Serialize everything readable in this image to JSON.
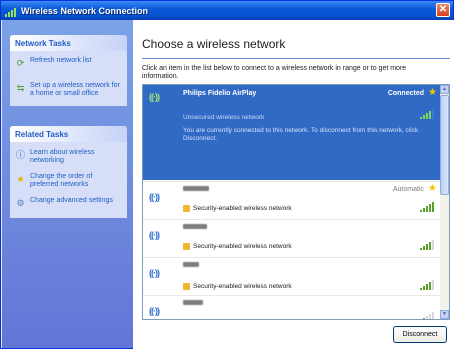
{
  "window": {
    "title": "Wireless Network Connection",
    "close_glyph": "✕"
  },
  "sidebar": {
    "network_tasks": {
      "header": "Network Tasks",
      "items": [
        {
          "label": "Refresh network list",
          "icon": "refresh-icon"
        },
        {
          "label": "Set up a wireless network for a home or small office",
          "icon": "setup-network-icon"
        }
      ]
    },
    "related_tasks": {
      "header": "Related Tasks",
      "items": [
        {
          "label": "Learn about wireless networking",
          "icon": "info-icon"
        },
        {
          "label": "Change the order of preferred networks",
          "icon": "star-icon"
        },
        {
          "label": "Change advanced settings",
          "icon": "settings-icon"
        }
      ]
    }
  },
  "main": {
    "title": "Choose a wireless network",
    "instructions": "Click an item in the list below to connect to a wireless network in range or to get more information.",
    "networks": [
      {
        "name": "Philips Fidelio AirPlay",
        "status": "Connected",
        "security": "Unsecured wireless network",
        "description": "You are currently connected to this network. To disconnect from this network, click Disconnect.",
        "selected": true,
        "signal": 4
      },
      {
        "name": "",
        "status": "Automatic",
        "security": "Security-enabled wireless network",
        "selected": false,
        "signal": 5
      },
      {
        "name": "",
        "status": "",
        "security": "Security-enabled wireless network",
        "selected": false,
        "signal": 4
      },
      {
        "name": "",
        "status": "",
        "security": "Security-enabled wireless network",
        "selected": false,
        "signal": 4
      },
      {
        "name": "",
        "status": "",
        "security": "",
        "selected": false,
        "signal": 2
      }
    ],
    "disconnect_label": "Disconnect"
  },
  "colors": {
    "selection": "#316ac5",
    "titlebar": "#0a5bd9",
    "link": "#215dc6",
    "signal": "#5aa02c"
  }
}
